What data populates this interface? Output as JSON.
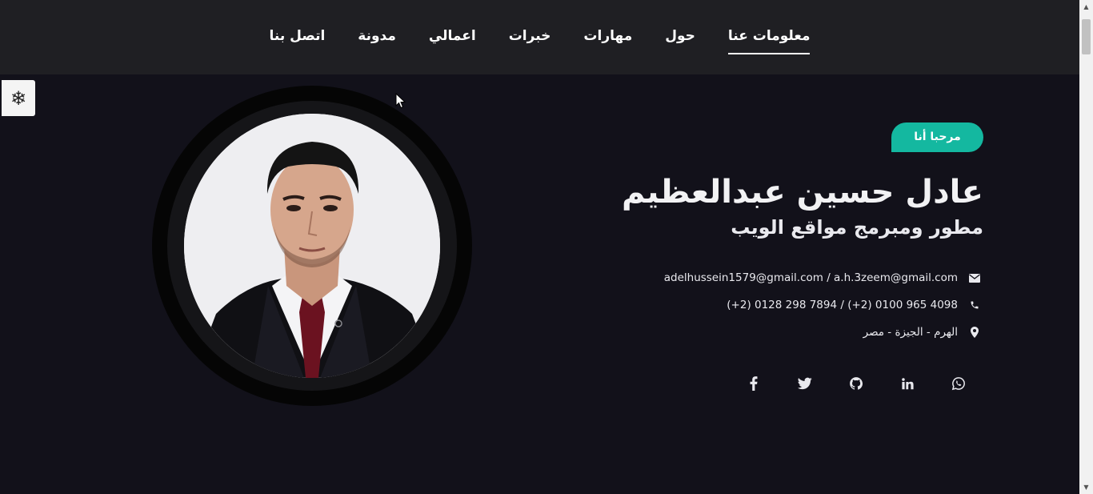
{
  "nav": {
    "items": [
      {
        "label": "معلومات عنا",
        "active": true
      },
      {
        "label": "حول",
        "active": false
      },
      {
        "label": "مهارات",
        "active": false
      },
      {
        "label": "خبرات",
        "active": false
      },
      {
        "label": "اعمالي",
        "active": false
      },
      {
        "label": "مدونة",
        "active": false
      },
      {
        "label": "اتصل بنا",
        "active": false
      }
    ]
  },
  "theme_toggle": {
    "icon": "snowflake-icon",
    "glyph": "❄"
  },
  "hero": {
    "badge": "مرحبا أنا",
    "name": "عادل حسين عبدالعظيم",
    "role": "مطور ومبرمج مواقع الويب",
    "contacts": {
      "email": "adelhussein1579@gmail.com / a.h.3zeem@gmail.com",
      "phone": "(+2) 0128 298 7894 / (+2) 0100 965 4098",
      "location": "الهرم - الجيزة - مصر"
    },
    "social": [
      "whatsapp-icon",
      "linkedin-icon",
      "github-icon",
      "twitter-icon",
      "facebook-icon"
    ]
  },
  "colors": {
    "background": "#12111a",
    "navbar": "#1f1f23",
    "accent": "#14b8a0"
  }
}
